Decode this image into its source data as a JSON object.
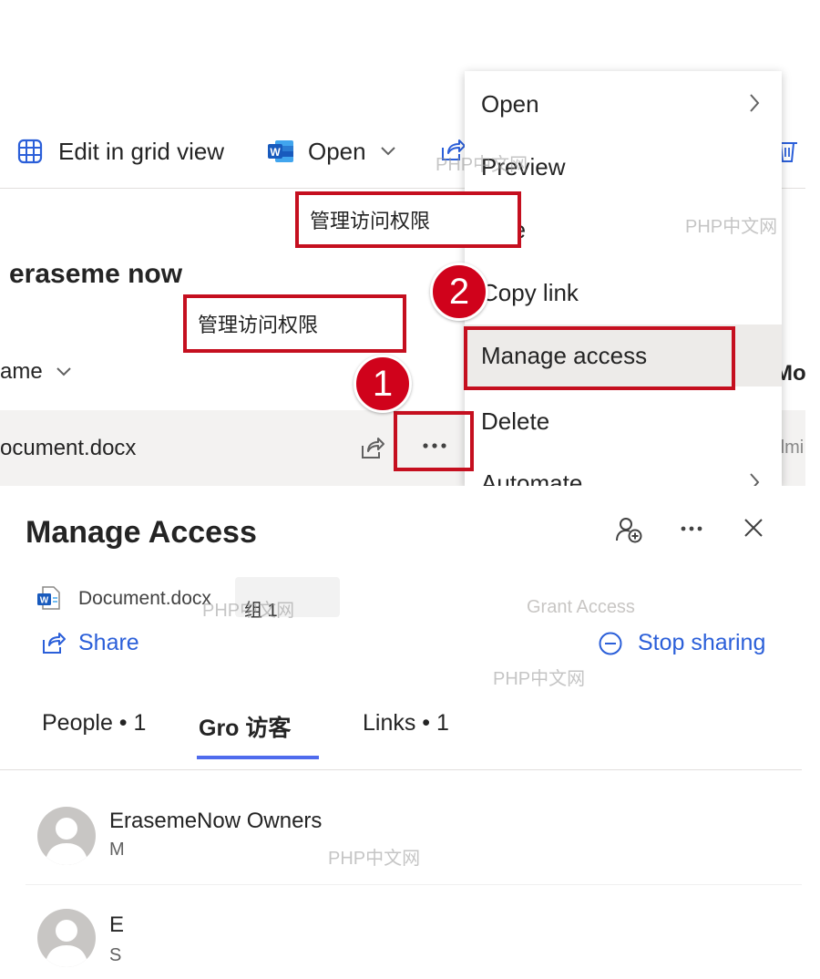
{
  "command_bar": {
    "edit_grid_label": "Edit in grid view",
    "open_label": "Open"
  },
  "library": {
    "title": "eraseme now",
    "column_header": "ame",
    "right_column_header": "Mo",
    "file_name": "ocument.docx",
    "right_cell": "dmi"
  },
  "context_menu": {
    "items": [
      {
        "label": "Open"
      },
      {
        "label": "Preview"
      },
      {
        "label": "re"
      },
      {
        "label": "Copy link"
      },
      {
        "label": "Manage access"
      },
      {
        "label": "Delete"
      },
      {
        "label": "Automate"
      }
    ]
  },
  "annotations": {
    "callout_text": "管理访问权限",
    "badge_1": "1",
    "badge_2": "2"
  },
  "manage_access": {
    "title": "Manage Access",
    "doc_name": "Document.docx",
    "group_overlay": "组 1",
    "grant_access": "Grant Access",
    "share_label": "Share",
    "stop_sharing_label": "Stop sharing",
    "tabs": [
      {
        "label": "People • 1"
      },
      {
        "label": "Gro 访客"
      },
      {
        "label": "Links • 1"
      }
    ],
    "people": [
      {
        "name": "ErasemeNow Owners",
        "sub": "M"
      },
      {
        "name": "E",
        "sub": "S"
      }
    ]
  },
  "watermarks": {
    "text": "PHP中文网"
  },
  "colors": {
    "accent_blue": "#2b5fd9",
    "tab_underline": "#4f6bed",
    "annotation_red": "#c50f1f",
    "badge_red": "#d0021b"
  }
}
